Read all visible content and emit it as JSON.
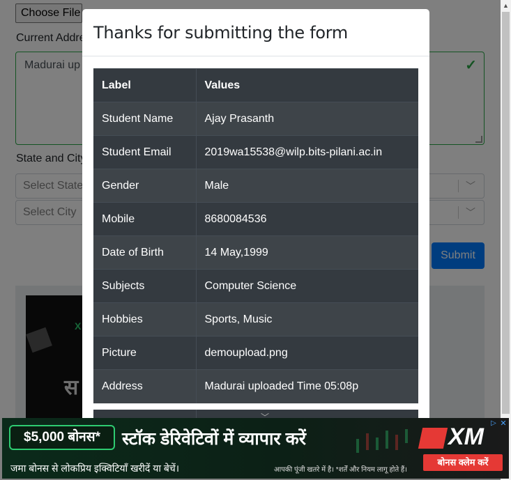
{
  "background": {
    "choose_file_label": "Choose File",
    "current_address_label": "Current Addre",
    "address_value": "Madurai up",
    "state_city_label": "State and City",
    "select_state_placeholder": "Select State",
    "select_city_placeholder": "Select City",
    "submit_label": "Submit"
  },
  "modal": {
    "title": "Thanks for submitting the form",
    "table": {
      "headers": [
        "Label",
        "Values"
      ],
      "rows": [
        {
          "label": "Student Name",
          "value": "Ajay Prasanth"
        },
        {
          "label": "Student Email",
          "value": "2019wa15538@wilp.bits-pilani.ac.in"
        },
        {
          "label": "Gender",
          "value": "Male"
        },
        {
          "label": "Mobile",
          "value": "8680084536"
        },
        {
          "label": "Date of Birth",
          "value": "14 May,1999"
        },
        {
          "label": "Subjects",
          "value": "Computer Science"
        },
        {
          "label": "Hobbies",
          "value": "Sports, Music"
        },
        {
          "label": "Picture",
          "value": "demoupload.png"
        },
        {
          "label": "Address",
          "value": "Madurai uploaded Time 05:08p"
        }
      ]
    }
  },
  "ad": {
    "badge": "$5,000 बोनस*",
    "headline": "स्टॉक डेरिवेटिवों में व्यापार करें",
    "subline": "जमा बोनस से लोकप्रिय इक्विटियाँ खरीदें या बेचें।",
    "disclaimer": "आपकी पूंजी खतरे में है। *शर्तें और नियम लागू होते हैं।",
    "logo": "XM",
    "cta": "बोनस क्लेम करें",
    "background_ad_letter": "X",
    "background_ad_text": "स"
  },
  "colors": {
    "primary": "#007bff",
    "valid": "#28a745",
    "table_dark": "#343a40",
    "ad_red": "#e53935",
    "ad_green": "#2ecc71"
  }
}
